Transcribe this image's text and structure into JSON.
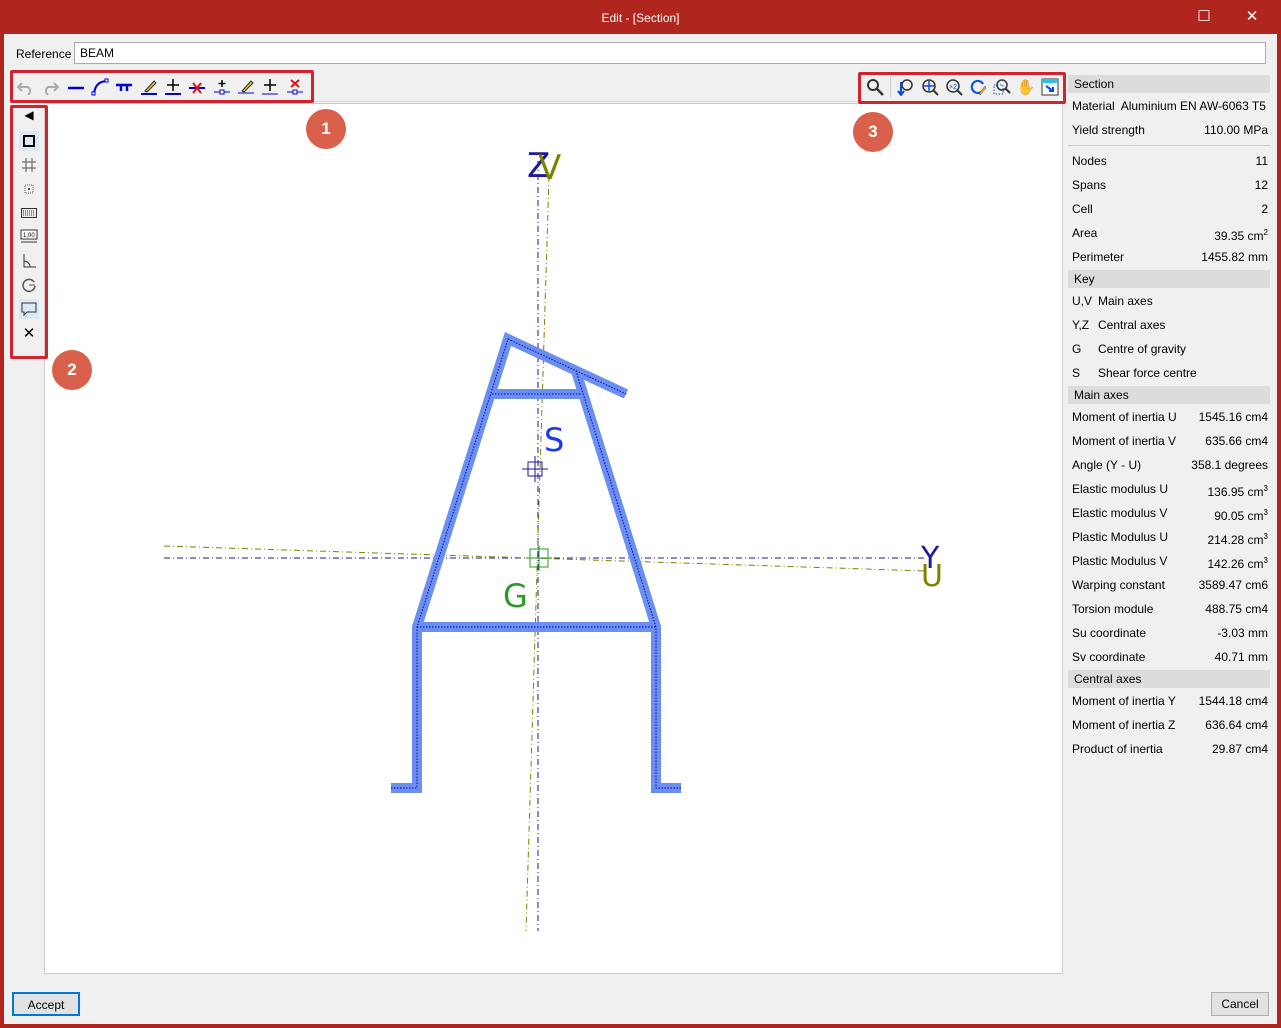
{
  "window": {
    "title": "Edit - [Section]",
    "maximize_icon": "maximize-icon",
    "close_icon": "close-icon"
  },
  "reference": {
    "label": "Reference",
    "value": "BEAM"
  },
  "toolbar_left": [
    "undo-icon",
    "redo-icon",
    "line-icon",
    "arc-icon",
    "offset-line-icon",
    "edit-span-icon",
    "move-span-icon",
    "delete-span-icon",
    "add-node-icon",
    "edit-node-icon",
    "move-node-icon",
    "delete-node-icon"
  ],
  "toolbar_right": [
    "zoom-icon",
    "zoom-previous-icon",
    "zoom-all-icon",
    "zoom-x2-icon",
    "redraw-icon",
    "zoom-window-icon",
    "pan-icon",
    "fit-window-icon"
  ],
  "left_tools": [
    "collapse-icon",
    "section-outline-icon",
    "grid-icon",
    "snap-icon",
    "keyboard-icon",
    "dimension-icon",
    "angle-icon",
    "rotate-icon",
    "comment-icon",
    "tools-icon"
  ],
  "badges": [
    "1",
    "2",
    "3"
  ],
  "drawing": {
    "axis_z": "Z",
    "axis_v": "V",
    "axis_y": "Y",
    "axis_u": "U",
    "label_s": "S",
    "label_g": "G",
    "section_color": "#6b8ff0",
    "main_axis_color": "#808000",
    "central_axis_color": "#1a1a9a",
    "g_color": "#2a9a2a"
  },
  "panel": {
    "section_header": "Section",
    "material_label": "Material",
    "material_value": "Aluminium EN AW-6063 T5",
    "yield_label": "Yield strength",
    "yield_value": "110.00 MPa",
    "props": [
      {
        "label": "Nodes",
        "value": "11"
      },
      {
        "label": "Spans",
        "value": "12"
      },
      {
        "label": "Cell",
        "value": "2"
      },
      {
        "label": "Area",
        "value": "39.35 cm",
        "sup": "2"
      },
      {
        "label": "Perimeter",
        "value": "1455.82 mm"
      }
    ],
    "key_header": "Key",
    "key": [
      {
        "k": "U,V",
        "v": "Main axes"
      },
      {
        "k": "Y,Z",
        "v": "Central axes"
      },
      {
        "k": "G",
        "v": "Centre of gravity"
      },
      {
        "k": "S",
        "v": "Shear force centre"
      }
    ],
    "main_header": "Main axes",
    "main": [
      {
        "label": "Moment of inertia U",
        "value": "1545.16 cm4"
      },
      {
        "label": "Moment of inertia V",
        "value": "635.66 cm4"
      },
      {
        "label": "Angle (Y - U)",
        "value": "358.1 degrees"
      },
      {
        "label": "Elastic modulus U",
        "value": "136.95 cm",
        "sup": "3"
      },
      {
        "label": "Elastic modulus V",
        "value": "90.05 cm",
        "sup": "3"
      },
      {
        "label": "Plastic Modulus U",
        "value": "214.28 cm",
        "sup": "3"
      },
      {
        "label": "Plastic Modulus V",
        "value": "142.26 cm",
        "sup": "3"
      },
      {
        "label": "Warping constant",
        "value": "3589.47 cm6"
      },
      {
        "label": "Torsion module",
        "value": "488.75 cm4"
      },
      {
        "label": "Su coordinate",
        "value": "-3.03 mm"
      },
      {
        "label": "Sv coordinate",
        "value": "40.71 mm"
      }
    ],
    "central_header": "Central axes",
    "central": [
      {
        "label": "Moment of inertia Y",
        "value": "1544.18 cm4"
      },
      {
        "label": "Moment of inertia Z",
        "value": "636.64 cm4"
      },
      {
        "label": "Product of inertia",
        "value": "29.87 cm4"
      }
    ]
  },
  "buttons": {
    "accept": "Accept",
    "cancel": "Cancel"
  }
}
